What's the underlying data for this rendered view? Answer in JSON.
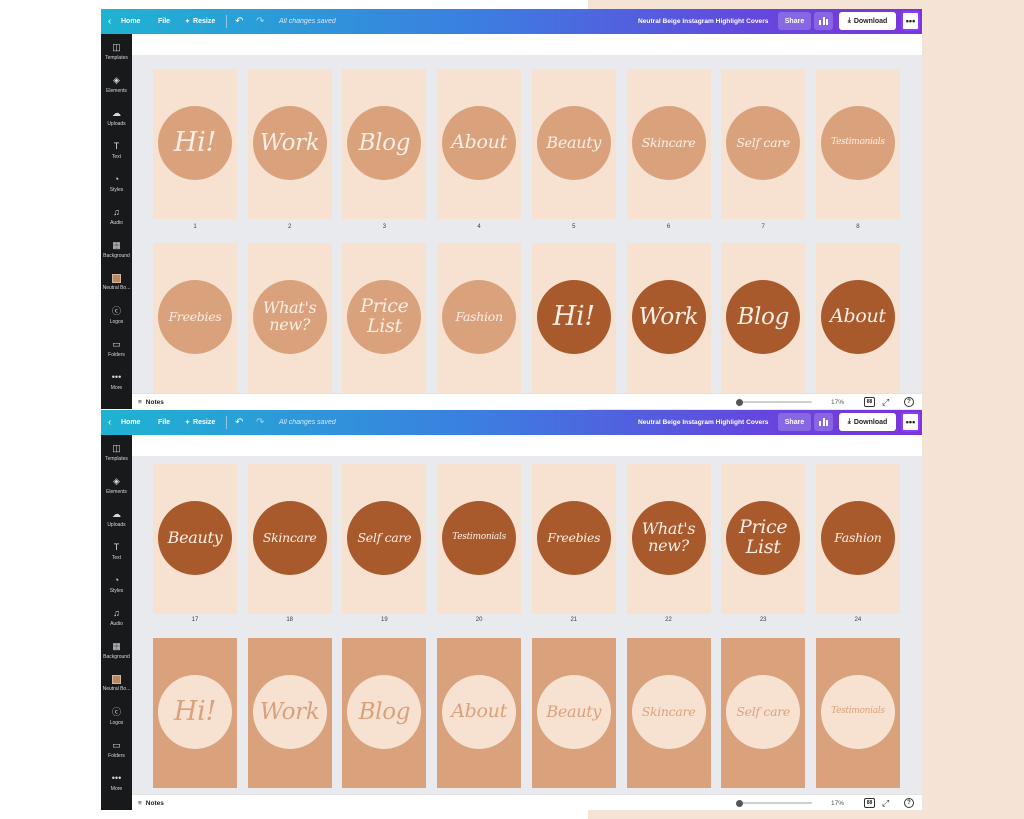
{
  "colors": {
    "page_light": "#f7e2d2",
    "page_tan": "#d9a27c",
    "circle_tan": "#d9a27c",
    "circle_brown": "#a85a2c",
    "circle_cream": "#f7e2d2",
    "script_on_dark": "#fbeee4",
    "script_on_cream": "#d9a27c",
    "outer_bg": "#f5e4d6"
  },
  "toolbar": {
    "home_label": "Home",
    "file_label": "File",
    "resize_label": "Resize",
    "saved_status": "All changes saved",
    "design_title": "Neutral Beige Instagram Highlight Covers",
    "share_label": "Share",
    "download_label": "Download",
    "more_label": "•••"
  },
  "sidebar": {
    "items": [
      {
        "label": "Templates",
        "icon": "templates-icon",
        "glyph": "◫"
      },
      {
        "label": "Elements",
        "icon": "elements-icon",
        "glyph": "◈"
      },
      {
        "label": "Uploads",
        "icon": "uploads-icon",
        "glyph": "☁"
      },
      {
        "label": "Text",
        "icon": "text-icon",
        "glyph": "T"
      },
      {
        "label": "Styles",
        "icon": "styles-icon",
        "glyph": "◔"
      },
      {
        "label": "Audio",
        "icon": "audio-icon",
        "glyph": "♫"
      },
      {
        "label": "Background",
        "icon": "background-icon",
        "glyph": "▦"
      },
      {
        "label": "Neutral Bo...",
        "icon": "neutral-board-icon",
        "glyph": ""
      },
      {
        "label": "Logos",
        "icon": "logos-icon",
        "glyph": "ⓒ"
      },
      {
        "label": "Folders",
        "icon": "folders-icon",
        "glyph": "▭"
      },
      {
        "label": "More",
        "icon": "more-icon",
        "glyph": "•••"
      }
    ]
  },
  "bottombar": {
    "notes_label": "Notes",
    "zoom_label": "17%",
    "grid_label": "88",
    "help_label": "?"
  },
  "screen1": {
    "row1": [
      {
        "text": "Hi!",
        "num": "1"
      },
      {
        "text": "Work",
        "num": "2"
      },
      {
        "text": "Blog",
        "num": "3"
      },
      {
        "text": "About",
        "num": "4"
      },
      {
        "text": "Beauty",
        "num": "5"
      },
      {
        "text": "Skincare",
        "num": "6"
      },
      {
        "text": "Self care",
        "num": "7"
      },
      {
        "text": "Testimonials",
        "num": "8"
      }
    ],
    "row2": [
      {
        "text": "Freebies",
        "style": "tan"
      },
      {
        "text": "What's\nnew?",
        "style": "tan"
      },
      {
        "text": "Price\nList",
        "style": "tan"
      },
      {
        "text": "Fashion",
        "style": "tan"
      },
      {
        "text": "Hi!",
        "style": "brown"
      },
      {
        "text": "Work",
        "style": "brown"
      },
      {
        "text": "Blog",
        "style": "brown"
      },
      {
        "text": "About",
        "style": "brown"
      }
    ]
  },
  "screen2": {
    "row1": [
      {
        "text": "Beauty",
        "num": "17"
      },
      {
        "text": "Skincare",
        "num": "18"
      },
      {
        "text": "Self care",
        "num": "19"
      },
      {
        "text": "Testimonials",
        "num": "20"
      },
      {
        "text": "Freebies",
        "num": "21"
      },
      {
        "text": "What's\nnew?",
        "num": "22"
      },
      {
        "text": "Price\nList",
        "num": "23"
      },
      {
        "text": "Fashion",
        "num": "24"
      }
    ],
    "row2": [
      {
        "text": "Hi!"
      },
      {
        "text": "Work"
      },
      {
        "text": "Blog"
      },
      {
        "text": "About"
      },
      {
        "text": "Beauty"
      },
      {
        "text": "Skincare"
      },
      {
        "text": "Self care"
      },
      {
        "text": "Testimonials"
      }
    ]
  }
}
